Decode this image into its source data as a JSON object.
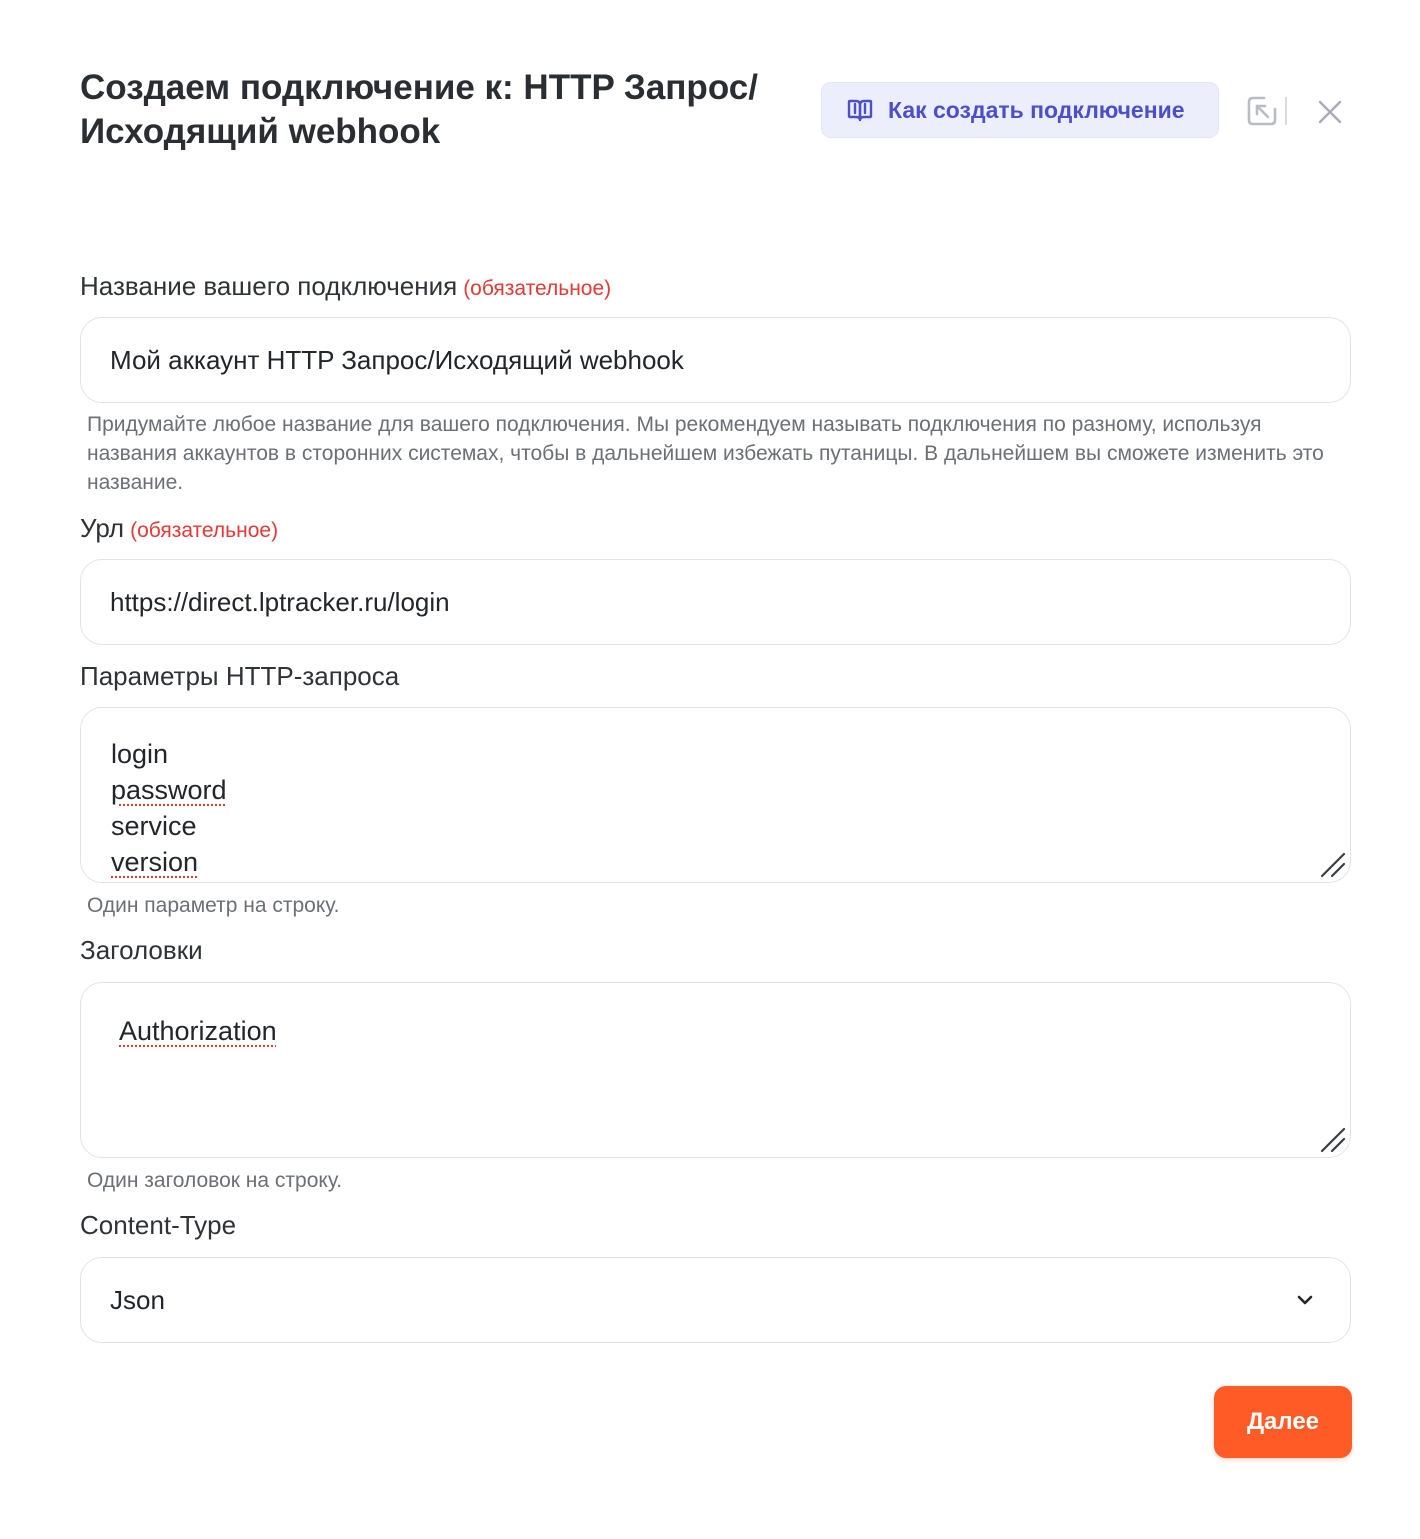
{
  "dialog": {
    "title": "Создаем подключение к: HTTP Запрос/\nИсходящий webhook",
    "howto_button": "Как создать подключение",
    "close_icon": "close-icon",
    "collapse_icon": "collapse-icon"
  },
  "fields": {
    "name": {
      "label": "Название вашего подключения",
      "required_tag": "(обязательное)",
      "value": "Мой аккаунт HTTP Запрос/Исходящий webhook",
      "help": "Придумайте любое название для вашего подключения. Мы рекомендуем называть подключения по разному, используя названия аккаунтов в сторонних системах, чтобы в дальнейшем избежать путаницы. В дальнейшем вы сможете изменить это название."
    },
    "url": {
      "label": "Урл",
      "required_tag": "(обязательное)",
      "value": "https://direct.lptracker.ru/login"
    },
    "params": {
      "label": "Параметры HTTP-запроса",
      "lines": [
        "login",
        "password",
        "service",
        "version"
      ],
      "help": "Один параметр на строку."
    },
    "headers": {
      "label": "Заголовки",
      "lines": [
        "Authorization"
      ],
      "help": "Один заголовок на строку."
    },
    "content_type": {
      "label": "Content-Type",
      "selected": "Json"
    }
  },
  "actions": {
    "next": "Далее"
  },
  "colors": {
    "accent": "#fe5b27",
    "link": "#4c4fc9",
    "required": "#e53935"
  }
}
